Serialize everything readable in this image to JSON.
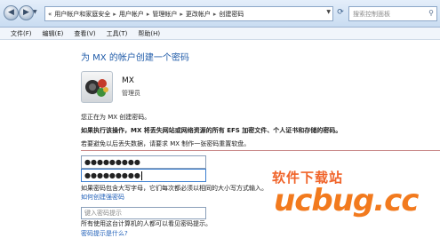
{
  "address_bar": {
    "crumb_lead": "«",
    "crumbs": [
      "用户帐户和家庭安全",
      "用户帐户",
      "管理帐户",
      "更改帐户",
      "创建密码"
    ],
    "search_placeholder": "搜索控制面板"
  },
  "menu": [
    "文件(F)",
    "编辑(E)",
    "查看(V)",
    "工具(T)",
    "帮助(H)"
  ],
  "page": {
    "title": "为 MX 的帐户创建一个密码",
    "user_name": "MX",
    "user_role": "管理员",
    "line_creating": "您正在为 MX 创建密码。",
    "line_warning": "如果执行该操作，MX 将丢失网站或网络资源的所有 EFS 加密文件、个人证书和存储的密码。",
    "line_tip": "若要避免以后丢失数据，请要求 MX 制作一张密码重置软盘。",
    "password_mask": "●●●●●●●●●",
    "confirm_mask": "●●●●●●●●●",
    "case_note": "如果密码包含大写字母，它们每次都必须以相同的大小写方式输入。",
    "strong_link": "如何创建强密码",
    "hint_placeholder": "键入密码提示",
    "hint_note": "所有使用这台计算机的人都可以看见密码提示。",
    "what_hint_link": "密码提示是什么?"
  },
  "watermark": {
    "line1": "软件下载站",
    "line2": "ucbug.cc",
    "color": "#f27a1e"
  },
  "colors": {
    "title_blue": "#1e5aa8",
    "link_blue": "#1f5fb8"
  }
}
